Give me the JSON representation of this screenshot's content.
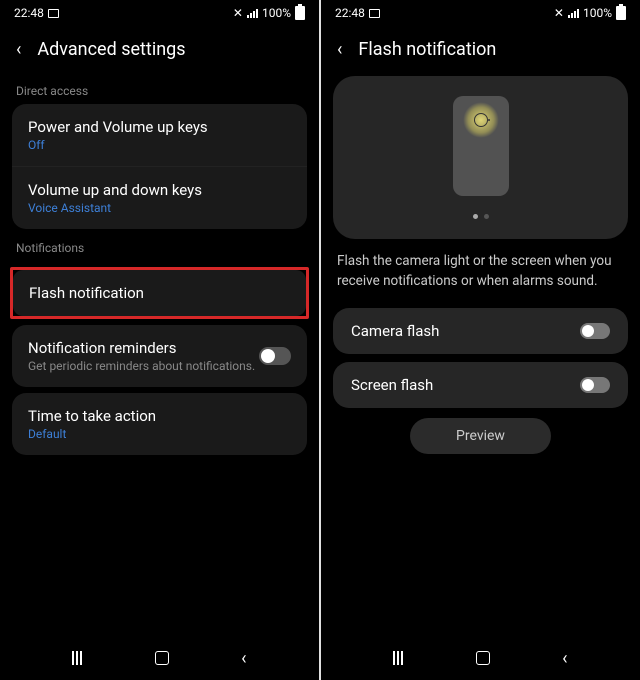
{
  "screen1": {
    "statusbar": {
      "time": "22:48",
      "battery": "100%"
    },
    "header": {
      "title": "Advanced settings"
    },
    "sections": {
      "direct_access": {
        "label": "Direct access",
        "items": [
          {
            "title": "Power and Volume up keys",
            "sub": "Off"
          },
          {
            "title": "Volume up and down keys",
            "sub": "Voice Assistant"
          }
        ]
      },
      "notifications": {
        "label": "Notifications",
        "highlighted": {
          "title": "Flash notification"
        },
        "reminders": {
          "title": "Notification reminders",
          "sub": "Get periodic reminders about notifications."
        },
        "time_action": {
          "title": "Time to take action",
          "sub": "Default"
        }
      }
    }
  },
  "screen2": {
    "statusbar": {
      "time": "22:48",
      "battery": "100%"
    },
    "header": {
      "title": "Flash notification"
    },
    "description": "Flash the camera light or the screen when you receive notifications or when alarms sound.",
    "toggles": {
      "camera": {
        "label": "Camera flash",
        "on": false
      },
      "screen": {
        "label": "Screen flash",
        "on": false
      }
    },
    "preview_button": "Preview"
  }
}
